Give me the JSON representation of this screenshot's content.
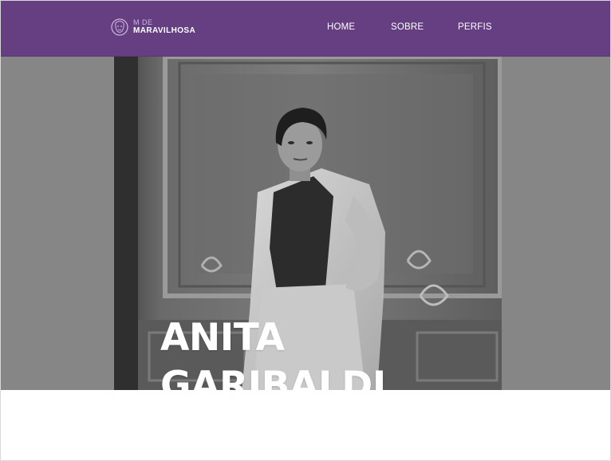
{
  "header": {
    "logo_small": "M DE",
    "logo_big": "MARAVILHOSA",
    "nav": [
      {
        "label": "HOME"
      },
      {
        "label": "SOBRE"
      },
      {
        "label": "PERFIS"
      }
    ]
  },
  "hero": {
    "title_line1": "ANITA",
    "title_line2": "GARIBALDI"
  },
  "colors": {
    "header_bg": "#663f83",
    "hero_bg": "#868686",
    "text": "#ffffff"
  }
}
